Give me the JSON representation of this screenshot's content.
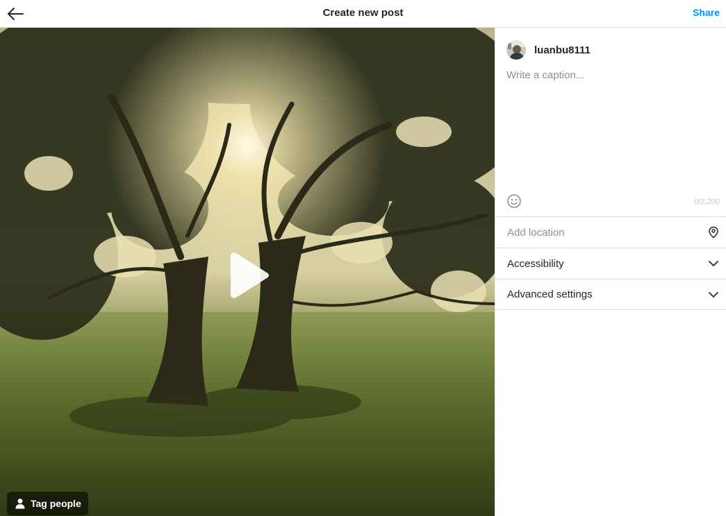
{
  "header": {
    "title": "Create new post",
    "share_label": "Share"
  },
  "media": {
    "type": "video",
    "tag_people_label": "Tag people"
  },
  "sidebar": {
    "username": "luanbu8111",
    "caption_placeholder": "Write a caption...",
    "caption_value": "",
    "char_count": "0/2,200",
    "location_placeholder": "Add location",
    "accessibility_label": "Accessibility",
    "advanced_label": "Advanced settings"
  },
  "colors": {
    "accent": "#0095f6",
    "divider": "#dbdbdb",
    "placeholder": "#8e8e8e"
  },
  "icons": [
    "back-arrow-icon",
    "play-icon",
    "person-icon",
    "emoji-icon",
    "location-pin-icon",
    "chevron-down-icon"
  ]
}
